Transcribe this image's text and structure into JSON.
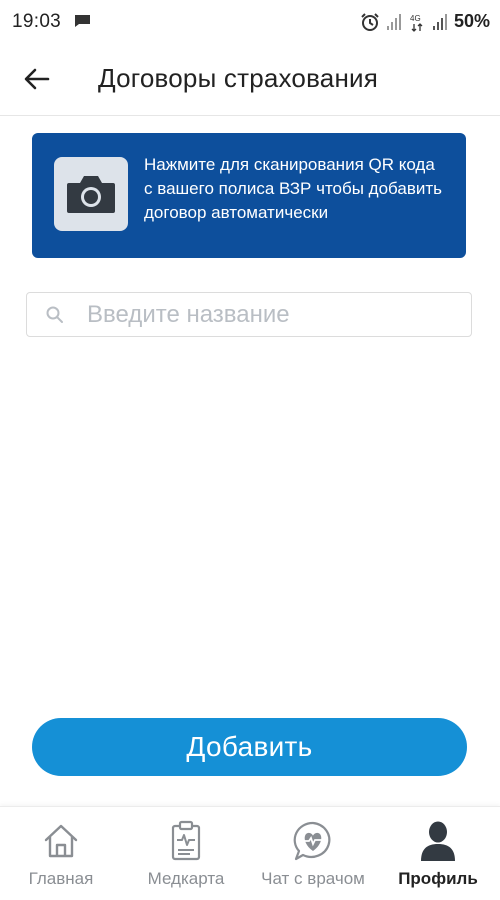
{
  "status_bar": {
    "time": "19:03",
    "battery": "50%",
    "icons": [
      "message-icon",
      "alarm-icon",
      "signal-icon",
      "4g-icon",
      "signal-icon"
    ]
  },
  "header": {
    "title": "Договоры страхования",
    "back_icon": "arrow-left-icon"
  },
  "scan_banner": {
    "text": "Нажмите для сканирования QR кода с вашего полиса ВЗР чтобы добавить договор автоматически",
    "icon": "camera-icon"
  },
  "search": {
    "placeholder": "Введите название",
    "value": ""
  },
  "add_button": {
    "label": "Добавить"
  },
  "bottom_nav": {
    "items": [
      {
        "label": "Главная",
        "icon": "home-icon",
        "active": false
      },
      {
        "label": "Медкарта",
        "icon": "medical-record-icon",
        "active": false
      },
      {
        "label": "Чат с врачом",
        "icon": "doctor-chat-icon",
        "active": false
      },
      {
        "label": "Профиль",
        "icon": "profile-icon",
        "active": true
      }
    ]
  },
  "colors": {
    "banner_bg": "#0d4f9c",
    "button_bg": "#1590d6",
    "text_primary": "#222222",
    "text_muted": "#8a8e93"
  }
}
